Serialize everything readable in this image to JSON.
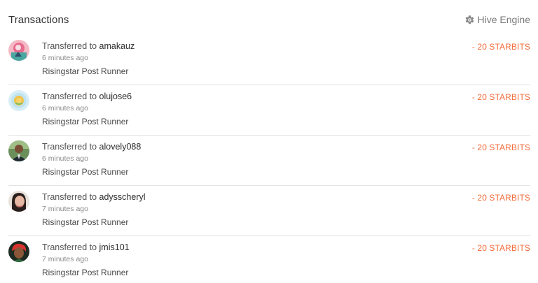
{
  "header": {
    "title": "Transactions",
    "engine_label": "Hive Engine",
    "engine_icon": "gear-icon"
  },
  "transactions": [
    {
      "prefix": "Transferred to",
      "user": "amakauz",
      "time": "6 minutes ago",
      "memo": "Risingstar Post Runner",
      "amount": "- 20 STARBITS"
    },
    {
      "prefix": "Transferred to",
      "user": "olujose6",
      "time": "6 minutes ago",
      "memo": "Risingstar Post Runner",
      "amount": "- 20 STARBITS"
    },
    {
      "prefix": "Transferred to",
      "user": "alovely088",
      "time": "6 minutes ago",
      "memo": "Risingstar Post Runner",
      "amount": "- 20 STARBITS"
    },
    {
      "prefix": "Transferred to",
      "user": "adysscheryl",
      "time": "7 minutes ago",
      "memo": "Risingstar Post Runner",
      "amount": "- 20 STARBITS"
    },
    {
      "prefix": "Transferred to",
      "user": "jmis101",
      "time": "7 minutes ago",
      "memo": "Risingstar Post Runner",
      "amount": "- 20 STARBITS"
    }
  ],
  "colors": {
    "amount": "#f26b3a",
    "divider": "#e3e3e3",
    "muted": "#8a8a8a"
  }
}
